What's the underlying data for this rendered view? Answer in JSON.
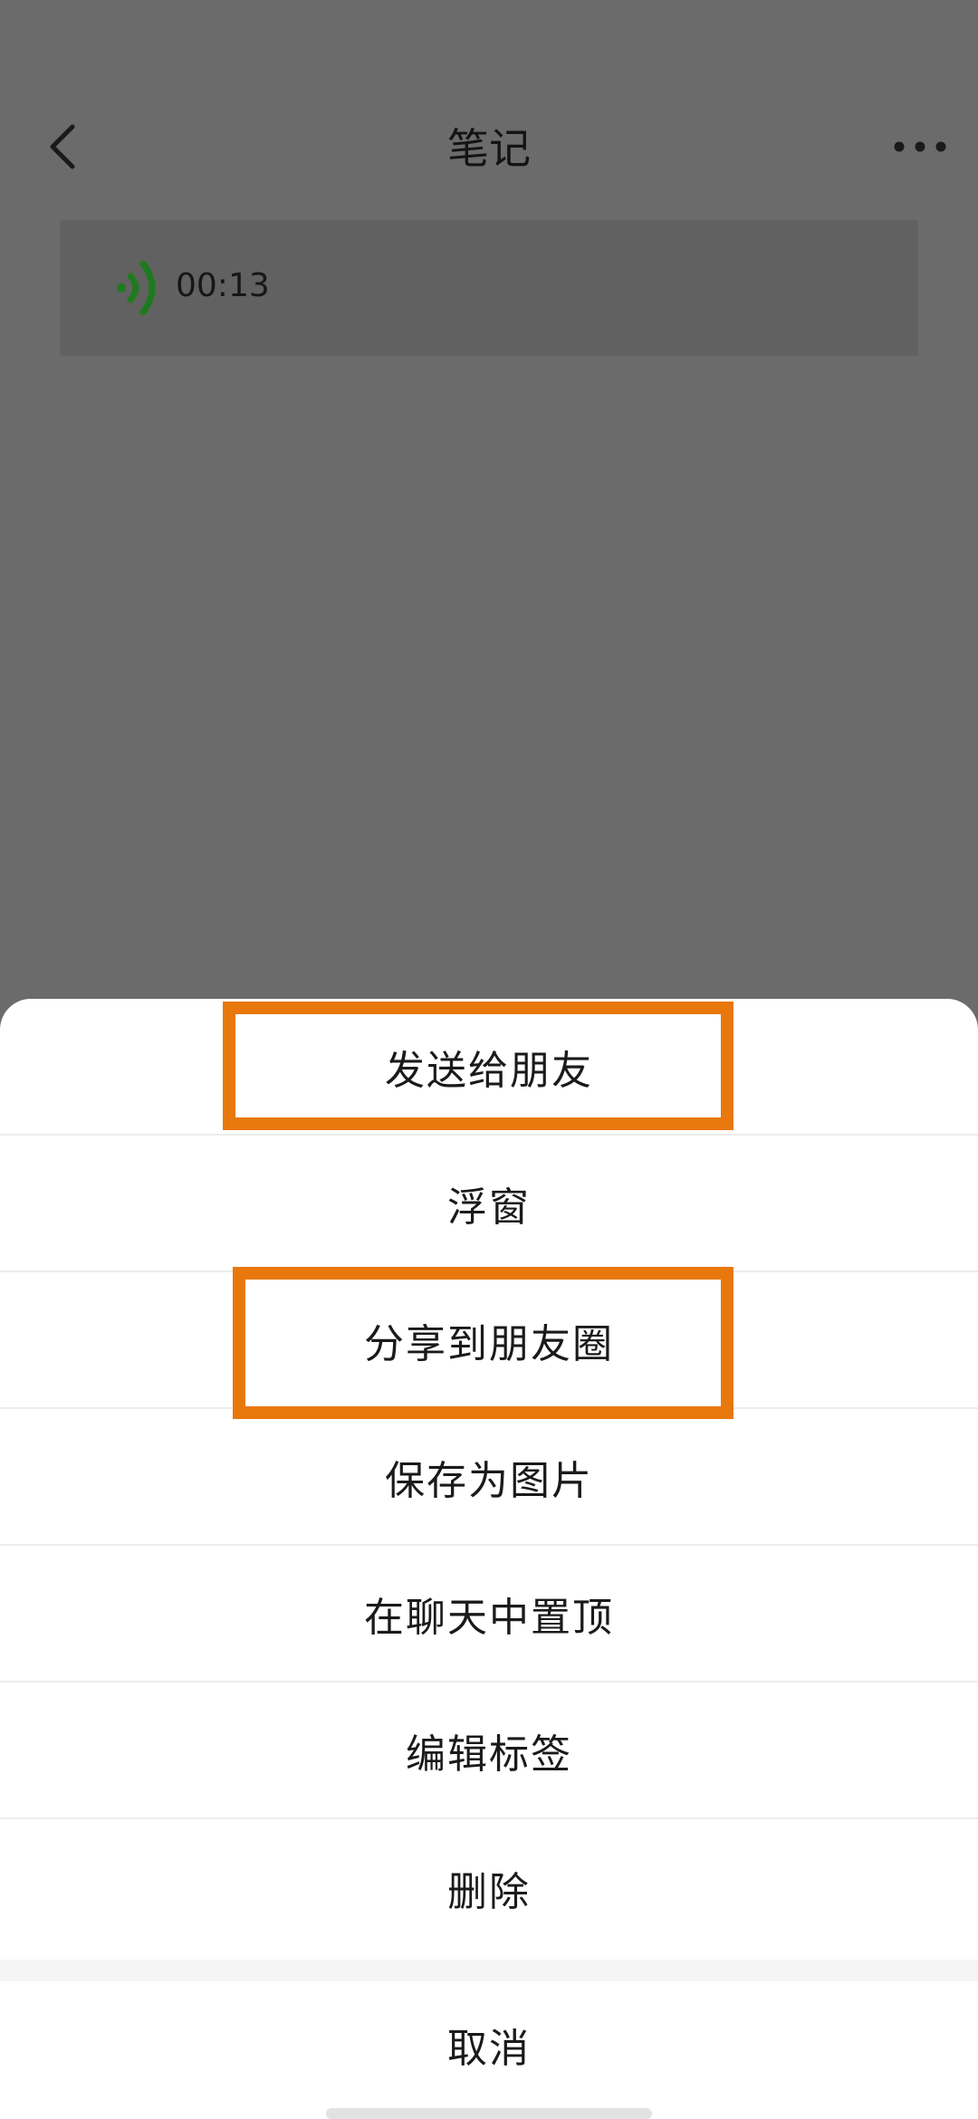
{
  "navbar": {
    "title": "笔记",
    "back_icon": "chevron-left-icon",
    "more_icon": "more-dots-icon"
  },
  "voice_note": {
    "duration": "00:13",
    "icon": "voice-wave-icon",
    "icon_color": "#1f7a1f"
  },
  "action_sheet": {
    "items": [
      {
        "label": "发送给朋友"
      },
      {
        "label": "浮窗"
      },
      {
        "label": "分享到朋友圈"
      },
      {
        "label": "保存为图片"
      },
      {
        "label": "在聊天中置顶"
      },
      {
        "label": "编辑标签"
      },
      {
        "label": "删除"
      }
    ],
    "cancel_label": "取消"
  },
  "colors": {
    "overlay": "#6b6b6b",
    "highlight": "#e8780c",
    "sheet_background": "#ffffff"
  }
}
